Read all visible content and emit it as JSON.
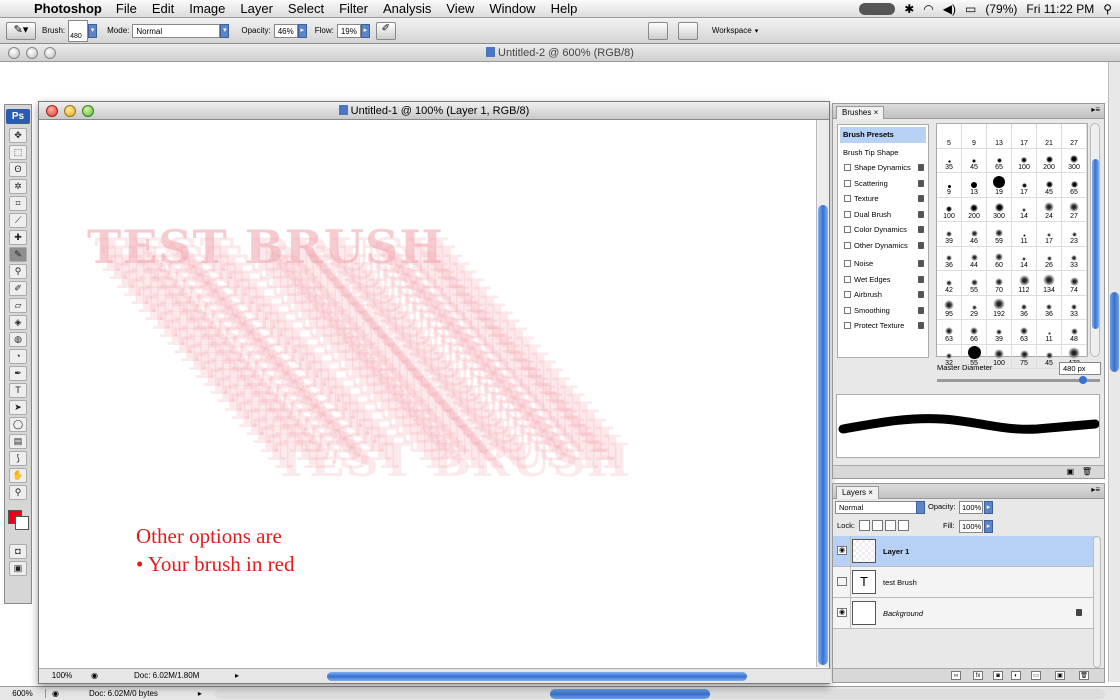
{
  "menubar": {
    "app_name": "Photoshop",
    "menus": [
      "File",
      "Edit",
      "Image",
      "Layer",
      "Select",
      "Filter",
      "Analysis",
      "View",
      "Window",
      "Help"
    ],
    "battery": "(79%)",
    "clock": "Fri 11:22 PM"
  },
  "options_bar": {
    "brush_label": "Brush:",
    "brush_size": "480",
    "mode_label": "Mode:",
    "mode_value": "Normal",
    "opacity_label": "Opacity:",
    "opacity_value": "46%",
    "flow_label": "Flow:",
    "flow_value": "19%",
    "workspace_label": "Workspace"
  },
  "doc2": {
    "title": "Untitled-2 @ 600% (RGB/8)",
    "zoom": "600%",
    "doc_info": "Doc: 6.02M/0 bytes"
  },
  "doc1": {
    "title": "Untitled-1 @ 100% (Layer 1, RGB/8)",
    "zoom": "100%",
    "doc_info": "Doc: 6.02M/1.80M",
    "canvas_text": "TEST BRUSH",
    "note_line1": "Other options are",
    "note_line2": "• Your brush in red"
  },
  "tools": {
    "logo": "Ps",
    "foreground_color": "#e8001c",
    "background_color": "#ffffff"
  },
  "brushes_panel": {
    "tab": "Brushes",
    "presets_label": "Brush Presets",
    "tip_shape_label": "Brush Tip Shape",
    "options": [
      "Shape Dynamics",
      "Scattering",
      "Texture",
      "Dual Brush",
      "Color Dynamics",
      "Other Dynamics",
      "Noise",
      "Wet Edges",
      "Airbrush",
      "Smoothing",
      "Protect Texture"
    ],
    "grid_labels": [
      "5",
      "9",
      "13",
      "17",
      "21",
      "27",
      "35",
      "45",
      "65",
      "100",
      "200",
      "300",
      "9",
      "13",
      "19",
      "17",
      "45",
      "65",
      "100",
      "200",
      "300",
      "14",
      "24",
      "27",
      "39",
      "46",
      "59",
      "11",
      "17",
      "23",
      "36",
      "44",
      "60",
      "14",
      "26",
      "33",
      "42",
      "55",
      "70",
      "112",
      "134",
      "74",
      "95",
      "29",
      "192",
      "36",
      "36",
      "33",
      "63",
      "66",
      "39",
      "63",
      "11",
      "48",
      "32",
      "55",
      "100",
      "75",
      "45",
      "478"
    ],
    "master_diameter_label": "Master Diameter",
    "master_diameter_value": "480 px"
  },
  "layers_panel": {
    "tab": "Layers",
    "blend_mode": "Normal",
    "opacity_label": "Opacity:",
    "opacity_value": "100%",
    "lock_label": "Lock:",
    "fill_label": "Fill:",
    "fill_value": "100%",
    "layers": [
      {
        "name": "Layer 1",
        "selected": true
      },
      {
        "name": "test Brush",
        "selected": false
      },
      {
        "name": "Background",
        "selected": false
      }
    ]
  }
}
